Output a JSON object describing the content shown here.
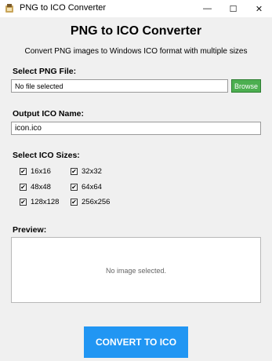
{
  "window": {
    "title": "PNG to ICO Converter",
    "controls": {
      "minimize": "—",
      "maximize": "☐",
      "close": "✕"
    }
  },
  "header": {
    "title": "PNG to ICO Converter",
    "subtitle": "Convert PNG images to Windows ICO format with multiple sizes"
  },
  "input_section": {
    "label": "Select PNG File:",
    "file_value": "No file selected",
    "browse_label": "Browse"
  },
  "output_section": {
    "label": "Output ICO Name:",
    "value": "icon.ico"
  },
  "sizes_section": {
    "label": "Select ICO Sizes:",
    "options": [
      {
        "label": "16x16",
        "checked": true
      },
      {
        "label": "32x32",
        "checked": true
      },
      {
        "label": "48x48",
        "checked": true
      },
      {
        "label": "64x64",
        "checked": true
      },
      {
        "label": "128x128",
        "checked": true
      },
      {
        "label": "256x256",
        "checked": true
      }
    ]
  },
  "preview_section": {
    "label": "Preview:",
    "placeholder": "No image selected."
  },
  "convert_label": "CONVERT TO ICO",
  "colors": {
    "browse_button": "#4caf50",
    "convert_button": "#2196f3",
    "background": "#f0f0f0"
  }
}
